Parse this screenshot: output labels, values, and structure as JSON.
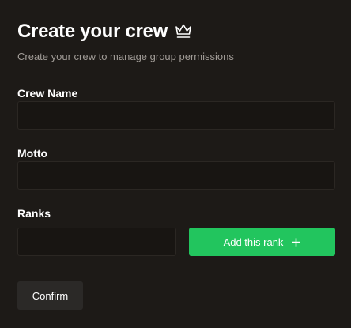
{
  "header": {
    "title": "Create your crew",
    "title_icon": "crown-icon",
    "subtitle": "Create your crew to manage group permissions"
  },
  "form": {
    "crew_name": {
      "label": "Crew Name",
      "value": "",
      "placeholder": ""
    },
    "motto": {
      "label": "Motto",
      "value": "",
      "placeholder": ""
    },
    "ranks": {
      "label": "Ranks",
      "value": "",
      "placeholder": "",
      "add_button_label": "Add this rank",
      "add_button_icon": "plus-icon"
    },
    "confirm_label": "Confirm"
  },
  "colors": {
    "background": "#1d1a17",
    "input_background": "#181512",
    "accent_green": "#22c55e",
    "secondary_button": "#2b2927",
    "muted_text": "#a19c97"
  }
}
